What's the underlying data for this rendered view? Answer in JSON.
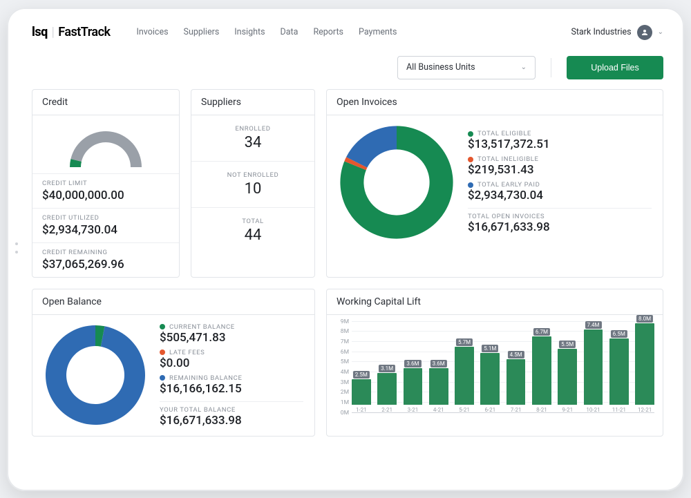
{
  "brand": {
    "logo": "lsq",
    "product": "FastTrack"
  },
  "nav": {
    "items": [
      "Invoices",
      "Suppliers",
      "Insights",
      "Data",
      "Reports",
      "Payments"
    ]
  },
  "account": {
    "name": "Stark Industries"
  },
  "filters": {
    "business_units": "All Business Units",
    "upload": "Upload Files"
  },
  "credit": {
    "title": "Credit",
    "limit_label": "CREDIT LIMIT",
    "limit": "$40,000,000.00",
    "utilized_label": "CREDIT UTILIZED",
    "utilized": "$2,934,730.04",
    "remaining_label": "CREDIT REMAINING",
    "remaining": "$37,065,269.96",
    "gauge_pct_used": 0.073
  },
  "suppliers": {
    "title": "Suppliers",
    "enrolled_label": "ENROLLED",
    "enrolled": "34",
    "not_enrolled_label": "NOT ENROLLED",
    "not_enrolled": "10",
    "total_label": "TOTAL",
    "total": "44"
  },
  "open_invoices": {
    "title": "Open Invoices",
    "items": [
      {
        "color": "#168a52",
        "label": "TOTAL ELIGIBLE",
        "value": "$13,517,372.51",
        "pct": 0.811
      },
      {
        "color": "#e4572e",
        "label": "TOTAL INELIGIBLE",
        "value": "$219,531.43",
        "pct": 0.013
      },
      {
        "color": "#2f6bb3",
        "label": "TOTAL EARLY PAID",
        "value": "$2,934,730.04",
        "pct": 0.176
      }
    ],
    "total_label": "TOTAL OPEN INVOICES",
    "total_value": "$16,671,633.98"
  },
  "open_balance": {
    "title": "Open Balance",
    "items": [
      {
        "color": "#168a52",
        "label": "CURRENT BALANCE",
        "value": "$505,471.83",
        "pct": 0.03
      },
      {
        "color": "#e4572e",
        "label": "LATE FEES",
        "value": "$0.00",
        "pct": 0.0
      },
      {
        "color": "#2f6bb3",
        "label": "REMAINING BALANCE",
        "value": "$16,166,162.15",
        "pct": 0.97
      }
    ],
    "total_label": "YOUR TOTAL BALANCE",
    "total_value": "$16,671,633.98"
  },
  "working_capital": {
    "title": "Working Capital Lift"
  },
  "chart_data": [
    {
      "id": "credit_gauge",
      "type": "gauge",
      "value": 2934730.04,
      "max": 40000000.0,
      "pct_used": 0.073
    },
    {
      "id": "open_invoices_donut",
      "type": "pie",
      "series": [
        {
          "name": "TOTAL ELIGIBLE",
          "value": 13517372.51,
          "color": "#168a52"
        },
        {
          "name": "TOTAL INELIGIBLE",
          "value": 219531.43,
          "color": "#e4572e"
        },
        {
          "name": "TOTAL EARLY PAID",
          "value": 2934730.04,
          "color": "#2f6bb3"
        }
      ],
      "total": 16671633.98
    },
    {
      "id": "open_balance_donut",
      "type": "pie",
      "series": [
        {
          "name": "CURRENT BALANCE",
          "value": 505471.83,
          "color": "#168a52"
        },
        {
          "name": "LATE FEES",
          "value": 0.0,
          "color": "#e4572e"
        },
        {
          "name": "REMAINING BALANCE",
          "value": 16166162.15,
          "color": "#2f6bb3"
        }
      ],
      "total": 16671633.98
    },
    {
      "id": "working_capital_lift",
      "type": "bar",
      "title": "Working Capital Lift",
      "ylabel": "",
      "ylim": [
        0,
        9
      ],
      "yticks": [
        0,
        1,
        2,
        3,
        4,
        5,
        6,
        7,
        8,
        9
      ],
      "ytick_suffix": "M",
      "categories": [
        "1-21",
        "2-21",
        "3-21",
        "4-21",
        "5-21",
        "6-21",
        "7-21",
        "8-21",
        "9-21",
        "10-21",
        "11-21",
        "12-21"
      ],
      "values": [
        2.5,
        3.1,
        3.6,
        3.6,
        5.7,
        5.1,
        4.5,
        6.7,
        5.5,
        7.4,
        6.5,
        8.0
      ],
      "value_labels": [
        "2.5M",
        "3.1M",
        "3.6M",
        "3.6M",
        "5.7M",
        "5.1M",
        "4.5M",
        "6.7M",
        "5.5M",
        "7.4M",
        "6.5M",
        "8.0M"
      ]
    }
  ]
}
